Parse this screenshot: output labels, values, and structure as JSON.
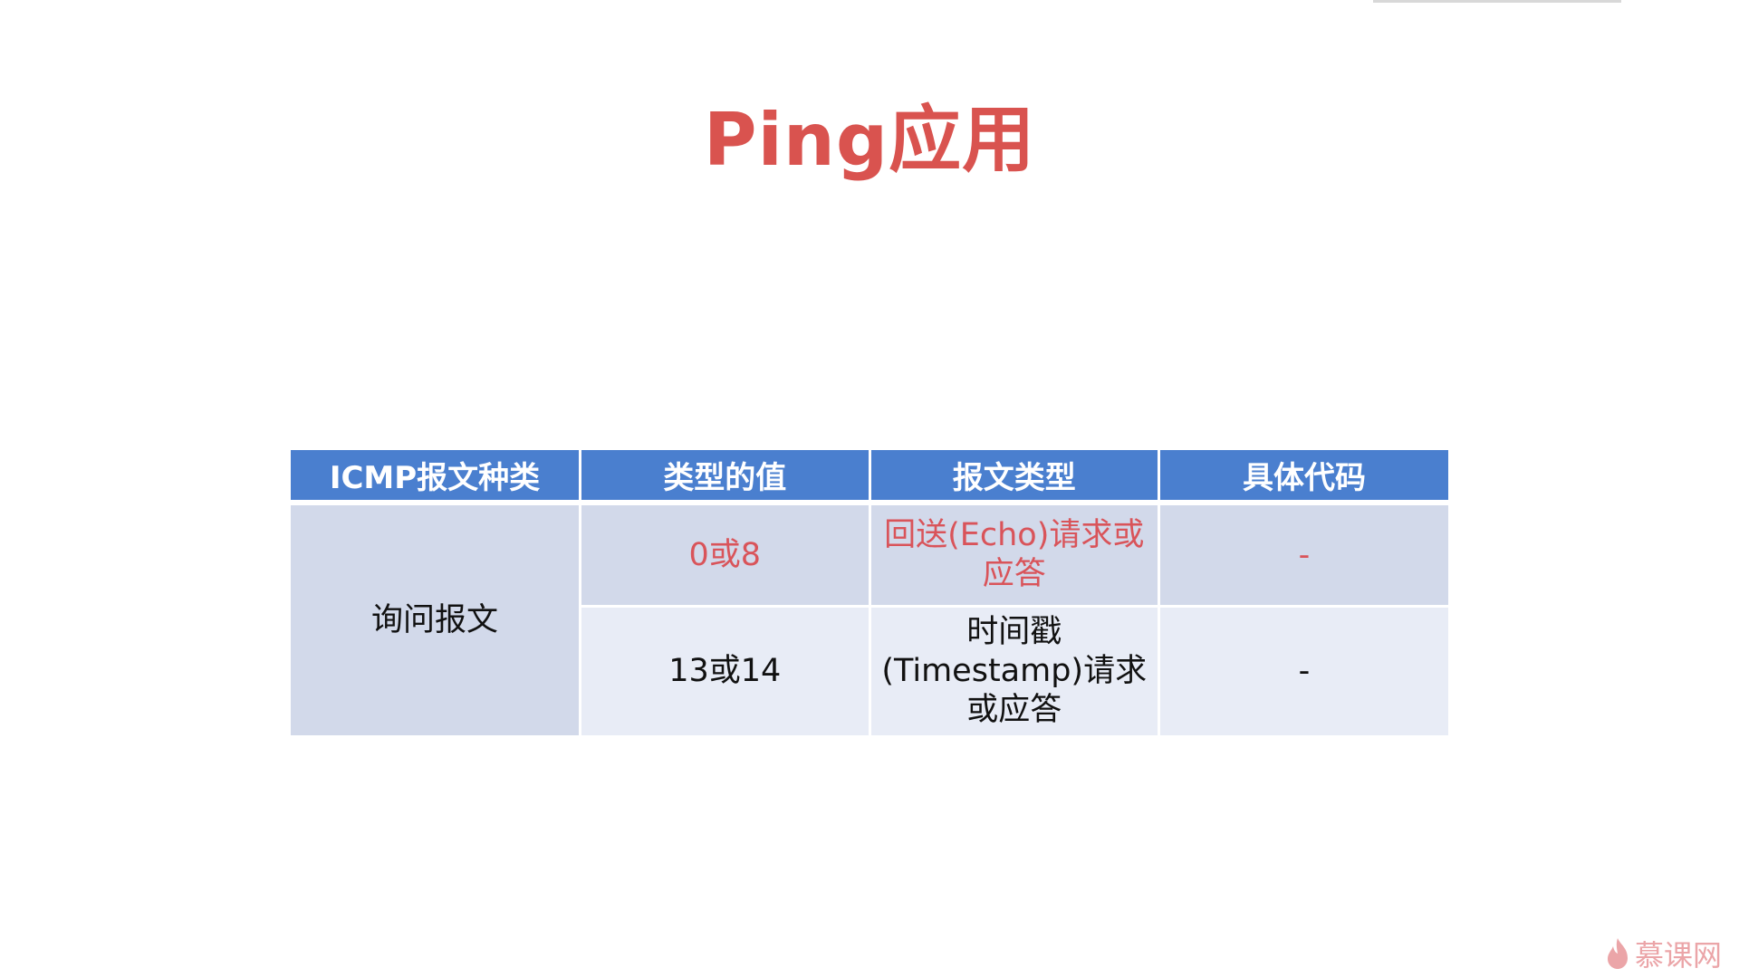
{
  "title": "Ping应用",
  "table": {
    "headers": [
      "ICMP报文种类",
      "类型的值",
      "报文类型",
      "具体代码"
    ],
    "category": "询问报文",
    "rows": [
      {
        "value": "0或8",
        "type": "回送(Echo)请求或应答",
        "code": "-",
        "highlight": true
      },
      {
        "value": "13或14",
        "type": "时间戳(Timestamp)请求或应答",
        "code": "-",
        "highlight": false
      }
    ]
  },
  "watermark": "慕课网",
  "colors": {
    "title": "#d9534f",
    "header": "#4a7fcf",
    "highlight_text": "#d9545a"
  }
}
